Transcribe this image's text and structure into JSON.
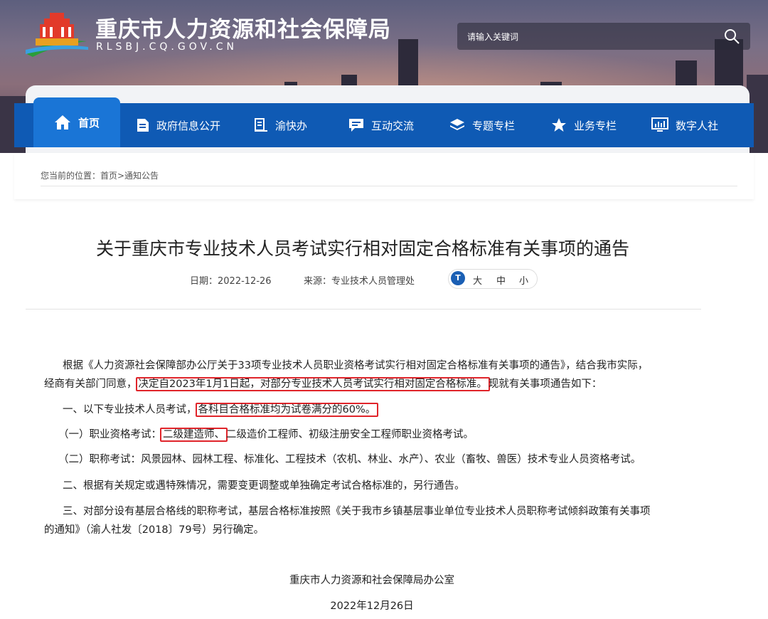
{
  "site": {
    "title": "重庆市人力资源和社会保障局",
    "domain": "RLSBJ.CQ.GOV.CN"
  },
  "search": {
    "placeholder": "请输入关键词",
    "icon": "search-icon"
  },
  "nav": {
    "items": [
      {
        "label": "首页",
        "icon": "home-icon"
      },
      {
        "label": "政府信息公开",
        "icon": "document-icon"
      },
      {
        "label": "渝快办",
        "icon": "list-icon"
      },
      {
        "label": "互动交流",
        "icon": "chat-icon"
      },
      {
        "label": "专题专栏",
        "icon": "layers-icon"
      },
      {
        "label": "业务专栏",
        "icon": "star-icon"
      },
      {
        "label": "数字人社",
        "icon": "monitor-icon"
      }
    ]
  },
  "breadcrumb": {
    "text": "您当前的位置：首页>通知公告"
  },
  "article": {
    "title": "关于重庆市专业技术人员考试实行相对固定合格标准有关事项的通告",
    "date_label": "日期：2022-12-26",
    "source_label": "来源：专业技术人员管理处",
    "font_size": {
      "icon_text": "T",
      "large": "大",
      "medium": "中",
      "small": "小"
    },
    "paragraphs": {
      "p1_line1": "根据《人力资源社会保障部办公厅关于33项专业技术人员职业资格考试实行相对固定合格标准有关事项的通告》，结合我市实际，",
      "p1_line2_pre": "经商有关部门同意，",
      "p1_line2_hl": "决定自2023年1月1日起，对部分专业技术人员考试实行相对固定合格标准。",
      "p1_line2_post": "现就有关事项通告如下：",
      "p2_pre": "一、以下专业技术人员考试，",
      "p2_hl": "各科目合格标准均为试卷满分的60%。",
      "p3_pre": "（一）职业资格考试：",
      "p3_hl": "二级建造师、",
      "p3_post": "二级造价工程师、初级注册安全工程师职业资格考试。",
      "p4": "（二）职称考试：风景园林、园林工程、标准化、工程技术（农机、林业、水产）、农业（畜牧、兽医）技术专业人员资格考试。",
      "p5": "二、根据有关规定或遇特殊情况，需要变更调整或单独确定考试合格标准的，另行通告。",
      "p6_line1": "三、对部分设有基层合格线的职称考试，基层合格标准按照《关于我市乡镇基层事业单位专业技术人员职称考试倾斜政策有关事项",
      "p6_line2": "的通知》（渝人社发〔2018〕79号）另行确定。"
    },
    "signature": "重庆市人力资源和社会保障局办公室",
    "sign_date": "2022年12月26日"
  },
  "colors": {
    "nav": "#0f5ab4",
    "nav_active": "#1a75d6",
    "highlight": "#e0242a"
  }
}
